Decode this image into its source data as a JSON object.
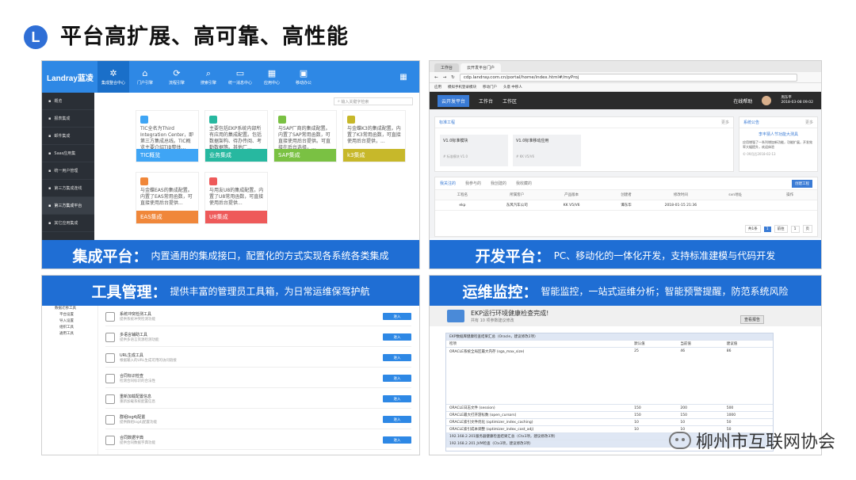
{
  "slide": {
    "icon_letter": "L",
    "title": "平台高扩展、高可靠、高性能",
    "watermark": "柳州市互联网协会"
  },
  "panel1": {
    "logo": "Landray蓝凌",
    "nav": [
      "集成整合中心",
      "门户引擎",
      "流程引擎",
      "搜索引擎",
      "统一消息中心",
      "应用中心",
      "移动办公"
    ],
    "sidebar": [
      "概览",
      "报表集成",
      "邮件集成",
      "Saas应用集",
      "统一用户管理",
      "第三方集成连线",
      "第三方集成平台",
      "其它应用集成"
    ],
    "search_placeholder": "输入关键字检索",
    "cards": [
      {
        "text": "TIC全名为Third Integration Center，即第三方集成总线。TIC概览主要介绍TIB整体...",
        "label": "TIC概览",
        "color": "#3fa5f5",
        "icon": "#3fa5f5"
      },
      {
        "text": "主要包括EKP系统内部所有应用的集成配置。包括数据架构、待办传阅、考勤数据等。其他厂...",
        "label": "业务集成",
        "color": "#27b8a0",
        "icon": "#27b8a0"
      },
      {
        "text": "与SAP厂商的集成配置。内置了SAP常用函数，可直接使用后台提供。可直接在后台选择，...",
        "label": "SAP集成",
        "color": "#7ac143",
        "icon": "#7ac143"
      },
      {
        "text": "与金蝶K3的集成配置。内置了K3常用函数，可直接使用后台提供，...",
        "label": "k3集成",
        "color": "#c7b82a",
        "icon": "#c7b82a"
      },
      {
        "text": "与金蝶EAS的集成配置。内置了EAS常用函数，可直接使用后台提供...",
        "label": "EAS集成",
        "color": "#f0873a",
        "icon": "#f0873a"
      },
      {
        "text": "与用友U8的集成配置。内置了U8常用函数，可直接使用后台提供...",
        "label": "U8集成",
        "color": "#ee5a5a",
        "icon": "#ee5a5a"
      }
    ],
    "caption_bold": "集成平台：",
    "caption_text": "内置通用的集成接口，配置化的方式实现各系统各类集成"
  },
  "panel2": {
    "tabs": [
      "工作台",
      "云开发平台门户"
    ],
    "url": "cdp.landray.com.cn/portal/home/index.html#/myProj",
    "bookmarks": [
      "应用",
      "模拟手机登录模块",
      "移动门户",
      "头意 中移人"
    ],
    "app_name": "云开发平台",
    "menus": [
      "工作台",
      "工作区"
    ],
    "help": "在线帮助",
    "user": "周东平",
    "user_time": "2018-03-08 09:02",
    "module_title": "标准工程",
    "module_more": "更多",
    "modules": [
      {
        "name": "V1.0标准模块",
        "sub": "# 标准模块 V1.0"
      },
      {
        "name": "V1.0标准移动应用",
        "sub": "# KK V5/V6"
      }
    ],
    "notice_title": "系统公告",
    "notice_more": "更多",
    "notice_headline": "李丰猜人节功能大测具",
    "notice_body": "应用增强了一系列增加新功能，功能扩展，开发效率大幅提升，欢迎体验",
    "notice_time": "© 09月后2018-02-13",
    "list_tabs": [
      "我关注的",
      "我参与的",
      "我创建的",
      "我收藏的"
    ],
    "new_button": "创建工程",
    "columns": [
      "工程名",
      "所属客户",
      "产品版本",
      "创建者",
      "修改时间",
      "svn地址",
      "操作"
    ],
    "row": [
      "ekp",
      "东风汽车公司",
      "KK V5/V6",
      "谭东华",
      "2018-01-15 21:36",
      "",
      ""
    ],
    "pager": [
      "共1条",
      "1",
      "前往",
      "1",
      "页"
    ],
    "caption_bold": "开发平台：",
    "caption_text": "PC、移动化的一体化开发，支持标准建模与代码开发"
  },
  "panel3": {
    "caption_bold": "工具管理：",
    "caption_text": "提供丰富的管理员工具箱，为日常运维保驾护航",
    "tree": [
      "数据迁移工具",
      "平台设置",
      "导入设置",
      "组织工具",
      "通用工具"
    ],
    "tools": [
      {
        "name": "系统冲突检测工具",
        "desc": "提供系统冲突检测功能"
      },
      {
        "name": "多语言辅助工具",
        "desc": "提供多语言资源检测功能"
      },
      {
        "name": "URL生成工具",
        "desc": "根据输入的URL生成可用的访问链接"
      },
      {
        "name": "合同标识检查",
        "desc": "检测合同标识的合法性"
      },
      {
        "name": "重新加载配置信息",
        "desc": "重新加载系统配置信息"
      },
      {
        "name": "群组log4j配置",
        "desc": "提供群组log4j配置功能"
      },
      {
        "name": "合同数据字典",
        "desc": "提供合同数据字典功能"
      }
    ],
    "enter_label": "进入"
  },
  "panel4": {
    "banner_title": "EKP运行环境健康检查完成!",
    "banner_sub": "共有 10 项参数建议修改",
    "banner_button": "查看报告",
    "table_title": "EKP数据库健康检查结果汇总（Oracle，建议修改2项）",
    "columns": [
      "检项",
      "默认值",
      "当前值",
      "建议值"
    ],
    "rows": [
      [
        "ORACLE系统全局区最大内存 (sga_max_size)",
        "25",
        "46",
        "86"
      ],
      [
        "ORACLE日志文件 (session)",
        "150",
        "200",
        "500"
      ],
      [
        "ORACLE最大打开游标数 (open_cursors)",
        "150",
        "150",
        "1000"
      ],
      [
        "ORACLE索引文件优化 (optimizer_index_caching)",
        "10",
        "10",
        "50"
      ],
      [
        "ORACLE索引成本调整 (optimizer_index_cost_adj)",
        "10",
        "10",
        "50"
      ]
    ],
    "section2": "192.168.2.201服务器健康检查结果汇总（Ctx3项，建议修改3项）",
    "section3": "192.168.2.201 JVM检查（Ctx3项，建议修改3项）",
    "caption_bold": "运维监控：",
    "caption_text": "智能监控，一站式运维分析；智能预警提醒，防范系统风险"
  }
}
